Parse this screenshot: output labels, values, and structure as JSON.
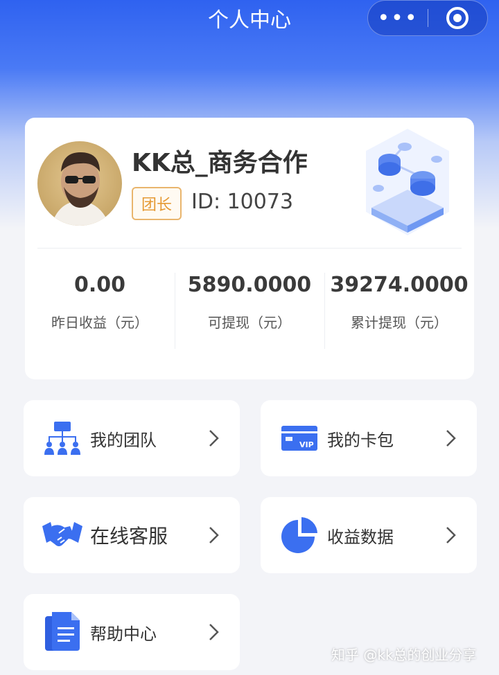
{
  "header": {
    "title": "个人中心",
    "more_glyph": "•••",
    "icons": [
      "more-icon",
      "close-target-icon"
    ]
  },
  "profile": {
    "username": "KK总_商务合作",
    "role": "团长",
    "id_text": "ID:  10073",
    "avatar": "avatar-icon"
  },
  "stats": [
    {
      "value": "0.00",
      "label": "昨日收益（元）"
    },
    {
      "value": "5890.0000",
      "label": "可提现（元）"
    },
    {
      "value": "39274.0000",
      "label": "累计提现（元）"
    }
  ],
  "menu": [
    {
      "label": "我的团队",
      "icon": "team-icon"
    },
    {
      "label": "我的卡包",
      "icon": "vip-card-icon"
    },
    {
      "label": "在线客服",
      "icon": "handshake-icon"
    },
    {
      "label": "收益数据",
      "icon": "pie-chart-icon"
    },
    {
      "label": "帮助中心",
      "icon": "document-icon"
    }
  ],
  "watermark": "知乎 @kk总的创业分享",
  "colors": {
    "accent": "#3b6ff0",
    "header_bg": "#2f62f0",
    "badge": "#e59a35",
    "page_bg": "#f3f4f8"
  }
}
